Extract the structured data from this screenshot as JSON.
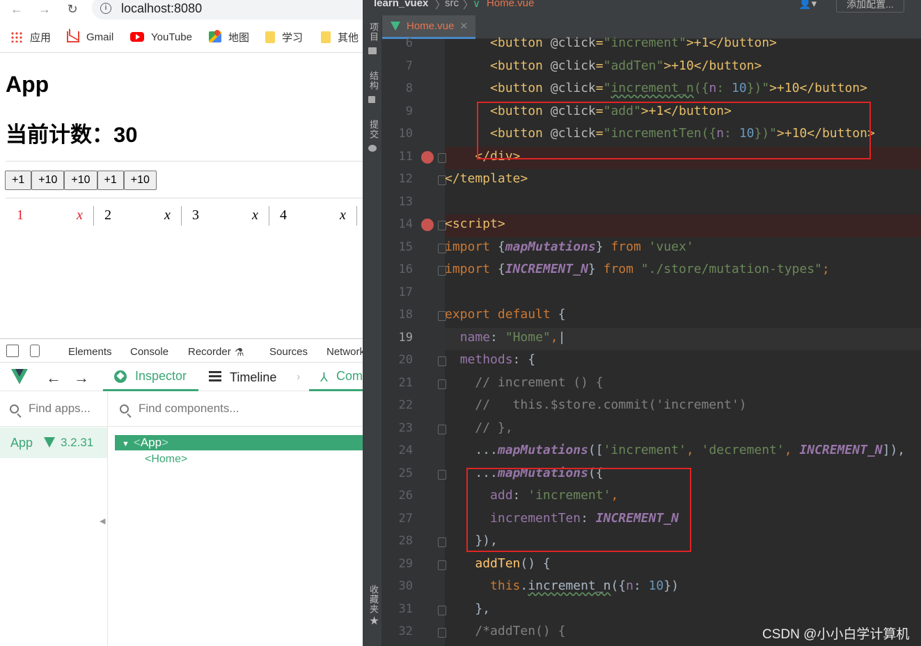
{
  "browser": {
    "url": "localhost:8080",
    "bookmarks": [
      {
        "label": "应用",
        "icon": "apps-grid-icon"
      },
      {
        "label": "Gmail",
        "icon": "gmail-icon"
      },
      {
        "label": "YouTube",
        "icon": "youtube-icon"
      },
      {
        "label": "地图",
        "icon": "maps-icon"
      },
      {
        "label": "学习",
        "icon": "folder-icon"
      },
      {
        "label": "其他",
        "icon": "folder-icon"
      }
    ]
  },
  "page": {
    "title": "App",
    "counter_text": "当前计数：30",
    "buttons": [
      "+1",
      "+10",
      "+10",
      "+1",
      "+10"
    ],
    "list": [
      {
        "num": "1",
        "x": "x",
        "color": "#e0202c"
      },
      {
        "num": "2",
        "x": "x",
        "color": "#000000"
      },
      {
        "num": "3",
        "x": "x",
        "color": "#000000"
      },
      {
        "num": "4",
        "x": "x",
        "color": "#000000"
      }
    ]
  },
  "devtools": {
    "tabs": [
      "Elements",
      "Console",
      "Recorder",
      "Sources",
      "Network"
    ],
    "vue_tabs": {
      "inspector": "Inspector",
      "timeline": "Timeline",
      "components": "Components"
    },
    "find_apps_placeholder": "Find apps...",
    "find_components_placeholder": "Find components...",
    "app_name": "App",
    "vue_version": "3.2.31",
    "tree": {
      "root_open": "<",
      "root_name": "App",
      "root_close": ">",
      "child": "<Home>"
    }
  },
  "ide": {
    "breadcrumb": [
      "learn_vuex",
      "src",
      "Home.vue"
    ],
    "add_config": "添加配置...",
    "tab": "Home.vue",
    "side_labels": [
      "项目",
      "结构",
      "提交",
      "收藏夹"
    ],
    "lines": [
      {
        "n": "6",
        "tokens": [
          [
            "      ",
            ""
          ],
          [
            "<button ",
            "t-tag"
          ],
          [
            "@click",
            "t-attr"
          ],
          [
            "=",
            "t-tag"
          ],
          [
            "\"increment\"",
            "t-str"
          ],
          [
            ">+1",
            "t-tag"
          ],
          [
            "</button>",
            "t-tag"
          ]
        ]
      },
      {
        "n": "7",
        "tokens": [
          [
            "      ",
            ""
          ],
          [
            "<button ",
            "t-tag"
          ],
          [
            "@click",
            "t-attr"
          ],
          [
            "=",
            "t-tag"
          ],
          [
            "\"addTen\"",
            "t-str"
          ],
          [
            ">+10",
            "t-tag"
          ],
          [
            "</button>",
            "t-tag"
          ]
        ]
      },
      {
        "n": "8",
        "tokens": [
          [
            "      ",
            ""
          ],
          [
            "<button ",
            "t-tag"
          ],
          [
            "@click",
            "t-attr"
          ],
          [
            "=",
            "t-tag"
          ],
          [
            "\"",
            "t-str"
          ],
          [
            "increment_n",
            "t-str t-wave"
          ],
          [
            "({",
            "t-str"
          ],
          [
            "n",
            "t-prop"
          ],
          [
            ": ",
            "t-str"
          ],
          [
            "10",
            "t-num"
          ],
          [
            "})\"",
            "t-str"
          ],
          [
            ">+10",
            "t-tag"
          ],
          [
            "</button>",
            "t-tag"
          ]
        ]
      },
      {
        "n": "9",
        "tokens": [
          [
            "      ",
            ""
          ],
          [
            "<button ",
            "t-tag"
          ],
          [
            "@click",
            "t-attr"
          ],
          [
            "=",
            "t-tag"
          ],
          [
            "\"add\"",
            "t-str"
          ],
          [
            ">+1",
            "t-tag"
          ],
          [
            "</button>",
            "t-tag"
          ]
        ]
      },
      {
        "n": "10",
        "tokens": [
          [
            "      ",
            ""
          ],
          [
            "<button ",
            "t-tag"
          ],
          [
            "@click",
            "t-attr"
          ],
          [
            "=",
            "t-tag"
          ],
          [
            "\"incrementTen({",
            "t-str"
          ],
          [
            "n",
            "t-prop"
          ],
          [
            ": ",
            "t-str"
          ],
          [
            "10",
            "t-num"
          ],
          [
            "})\"",
            "t-str"
          ],
          [
            ">+10",
            "t-tag"
          ],
          [
            "</button>",
            "t-tag"
          ]
        ]
      },
      {
        "n": "11",
        "bp": true,
        "fold": true,
        "tokens": [
          [
            "    ",
            ""
          ],
          [
            "</div>",
            "t-tag"
          ]
        ]
      },
      {
        "n": "12",
        "fold": true,
        "tokens": [
          [
            "",
            "",
            ""
          ],
          [
            "</template>",
            "t-tag"
          ]
        ]
      },
      {
        "n": "13",
        "tokens": []
      },
      {
        "n": "14",
        "bp": true,
        "fold": true,
        "tokens": [
          [
            "<script>",
            "t-tag"
          ]
        ]
      },
      {
        "n": "15",
        "fold": true,
        "tokens": [
          [
            "import ",
            "t-kw"
          ],
          [
            "{",
            ""
          ],
          [
            "mapMutations",
            "t-fn"
          ],
          [
            "} ",
            ""
          ],
          [
            "from ",
            "t-kw"
          ],
          [
            "'vuex'",
            "t-str"
          ]
        ]
      },
      {
        "n": "16",
        "fold": true,
        "tokens": [
          [
            "import ",
            "t-kw"
          ],
          [
            "{",
            ""
          ],
          [
            "INCREMENT_N",
            "t-fn"
          ],
          [
            "} ",
            ""
          ],
          [
            "from ",
            "t-kw"
          ],
          [
            "\"./store/mutation-types\"",
            "t-str"
          ],
          [
            ";",
            "t-kw"
          ]
        ]
      },
      {
        "n": "17",
        "tokens": []
      },
      {
        "n": "18",
        "fold": true,
        "tokens": [
          [
            "export default ",
            "t-kw"
          ],
          [
            "{",
            ""
          ]
        ]
      },
      {
        "n": "19",
        "cur": true,
        "tokens": [
          [
            "  ",
            ""
          ],
          [
            "name",
            "t-prop"
          ],
          [
            ": ",
            ""
          ],
          [
            "\"Home\"",
            "t-str"
          ],
          [
            ",",
            "t-kw"
          ],
          [
            "|",
            ""
          ]
        ]
      },
      {
        "n": "20",
        "fold": true,
        "tokens": [
          [
            "  ",
            ""
          ],
          [
            "methods",
            "t-prop"
          ],
          [
            ": {",
            ""
          ]
        ]
      },
      {
        "n": "21",
        "fold": true,
        "tokens": [
          [
            "    ",
            ""
          ],
          [
            "// increment () {",
            "t-cm"
          ]
        ]
      },
      {
        "n": "22",
        "tokens": [
          [
            "    ",
            ""
          ],
          [
            "//   this.$store.commit('increment')",
            "t-cm"
          ]
        ]
      },
      {
        "n": "23",
        "fold": true,
        "tokens": [
          [
            "    ",
            ""
          ],
          [
            "// },",
            "t-cm"
          ]
        ]
      },
      {
        "n": "24",
        "tokens": [
          [
            "    ...",
            ""
          ],
          [
            "mapMutations",
            "t-fn"
          ],
          [
            "([",
            ""
          ],
          [
            "'increment'",
            "t-str"
          ],
          [
            ", ",
            "t-kw"
          ],
          [
            "'decrement'",
            "t-str"
          ],
          [
            ", ",
            "t-kw"
          ],
          [
            "INCREMENT_N",
            "t-fn"
          ],
          [
            "]),",
            ""
          ]
        ]
      },
      {
        "n": "25",
        "fold": true,
        "tokens": [
          [
            "    ...",
            ""
          ],
          [
            "mapMutations",
            "t-fn"
          ],
          [
            "({",
            ""
          ]
        ]
      },
      {
        "n": "26",
        "tokens": [
          [
            "      ",
            ""
          ],
          [
            "add",
            "t-prop"
          ],
          [
            ": ",
            ""
          ],
          [
            "'increment'",
            "t-str"
          ],
          [
            ",",
            "t-kw"
          ]
        ]
      },
      {
        "n": "27",
        "tokens": [
          [
            "      ",
            ""
          ],
          [
            "incrementTen",
            "t-prop"
          ],
          [
            ": ",
            ""
          ],
          [
            "INCREMENT_N",
            "t-fn"
          ]
        ]
      },
      {
        "n": "28",
        "fold": true,
        "tokens": [
          [
            "    }),",
            ""
          ]
        ]
      },
      {
        "n": "29",
        "fold": true,
        "tokens": [
          [
            "    ",
            ""
          ],
          [
            "addTen",
            "t-mth"
          ],
          [
            "() {",
            ""
          ]
        ]
      },
      {
        "n": "30",
        "tokens": [
          [
            "      ",
            ""
          ],
          [
            "this",
            "t-kw"
          ],
          [
            ".",
            ""
          ],
          [
            "increment_n",
            "t-wave"
          ],
          [
            "({",
            ""
          ],
          [
            "n",
            "t-prop"
          ],
          [
            ": ",
            ""
          ],
          [
            "10",
            "t-num"
          ],
          [
            "})",
            ""
          ]
        ]
      },
      {
        "n": "31",
        "fold": true,
        "tokens": [
          [
            "    },",
            ""
          ]
        ]
      },
      {
        "n": "32",
        "fold": true,
        "tokens": [
          [
            "    ",
            ""
          ],
          [
            "/*addTen() {",
            "t-cm"
          ]
        ]
      }
    ]
  },
  "watermark": "CSDN @小小白学计算机"
}
